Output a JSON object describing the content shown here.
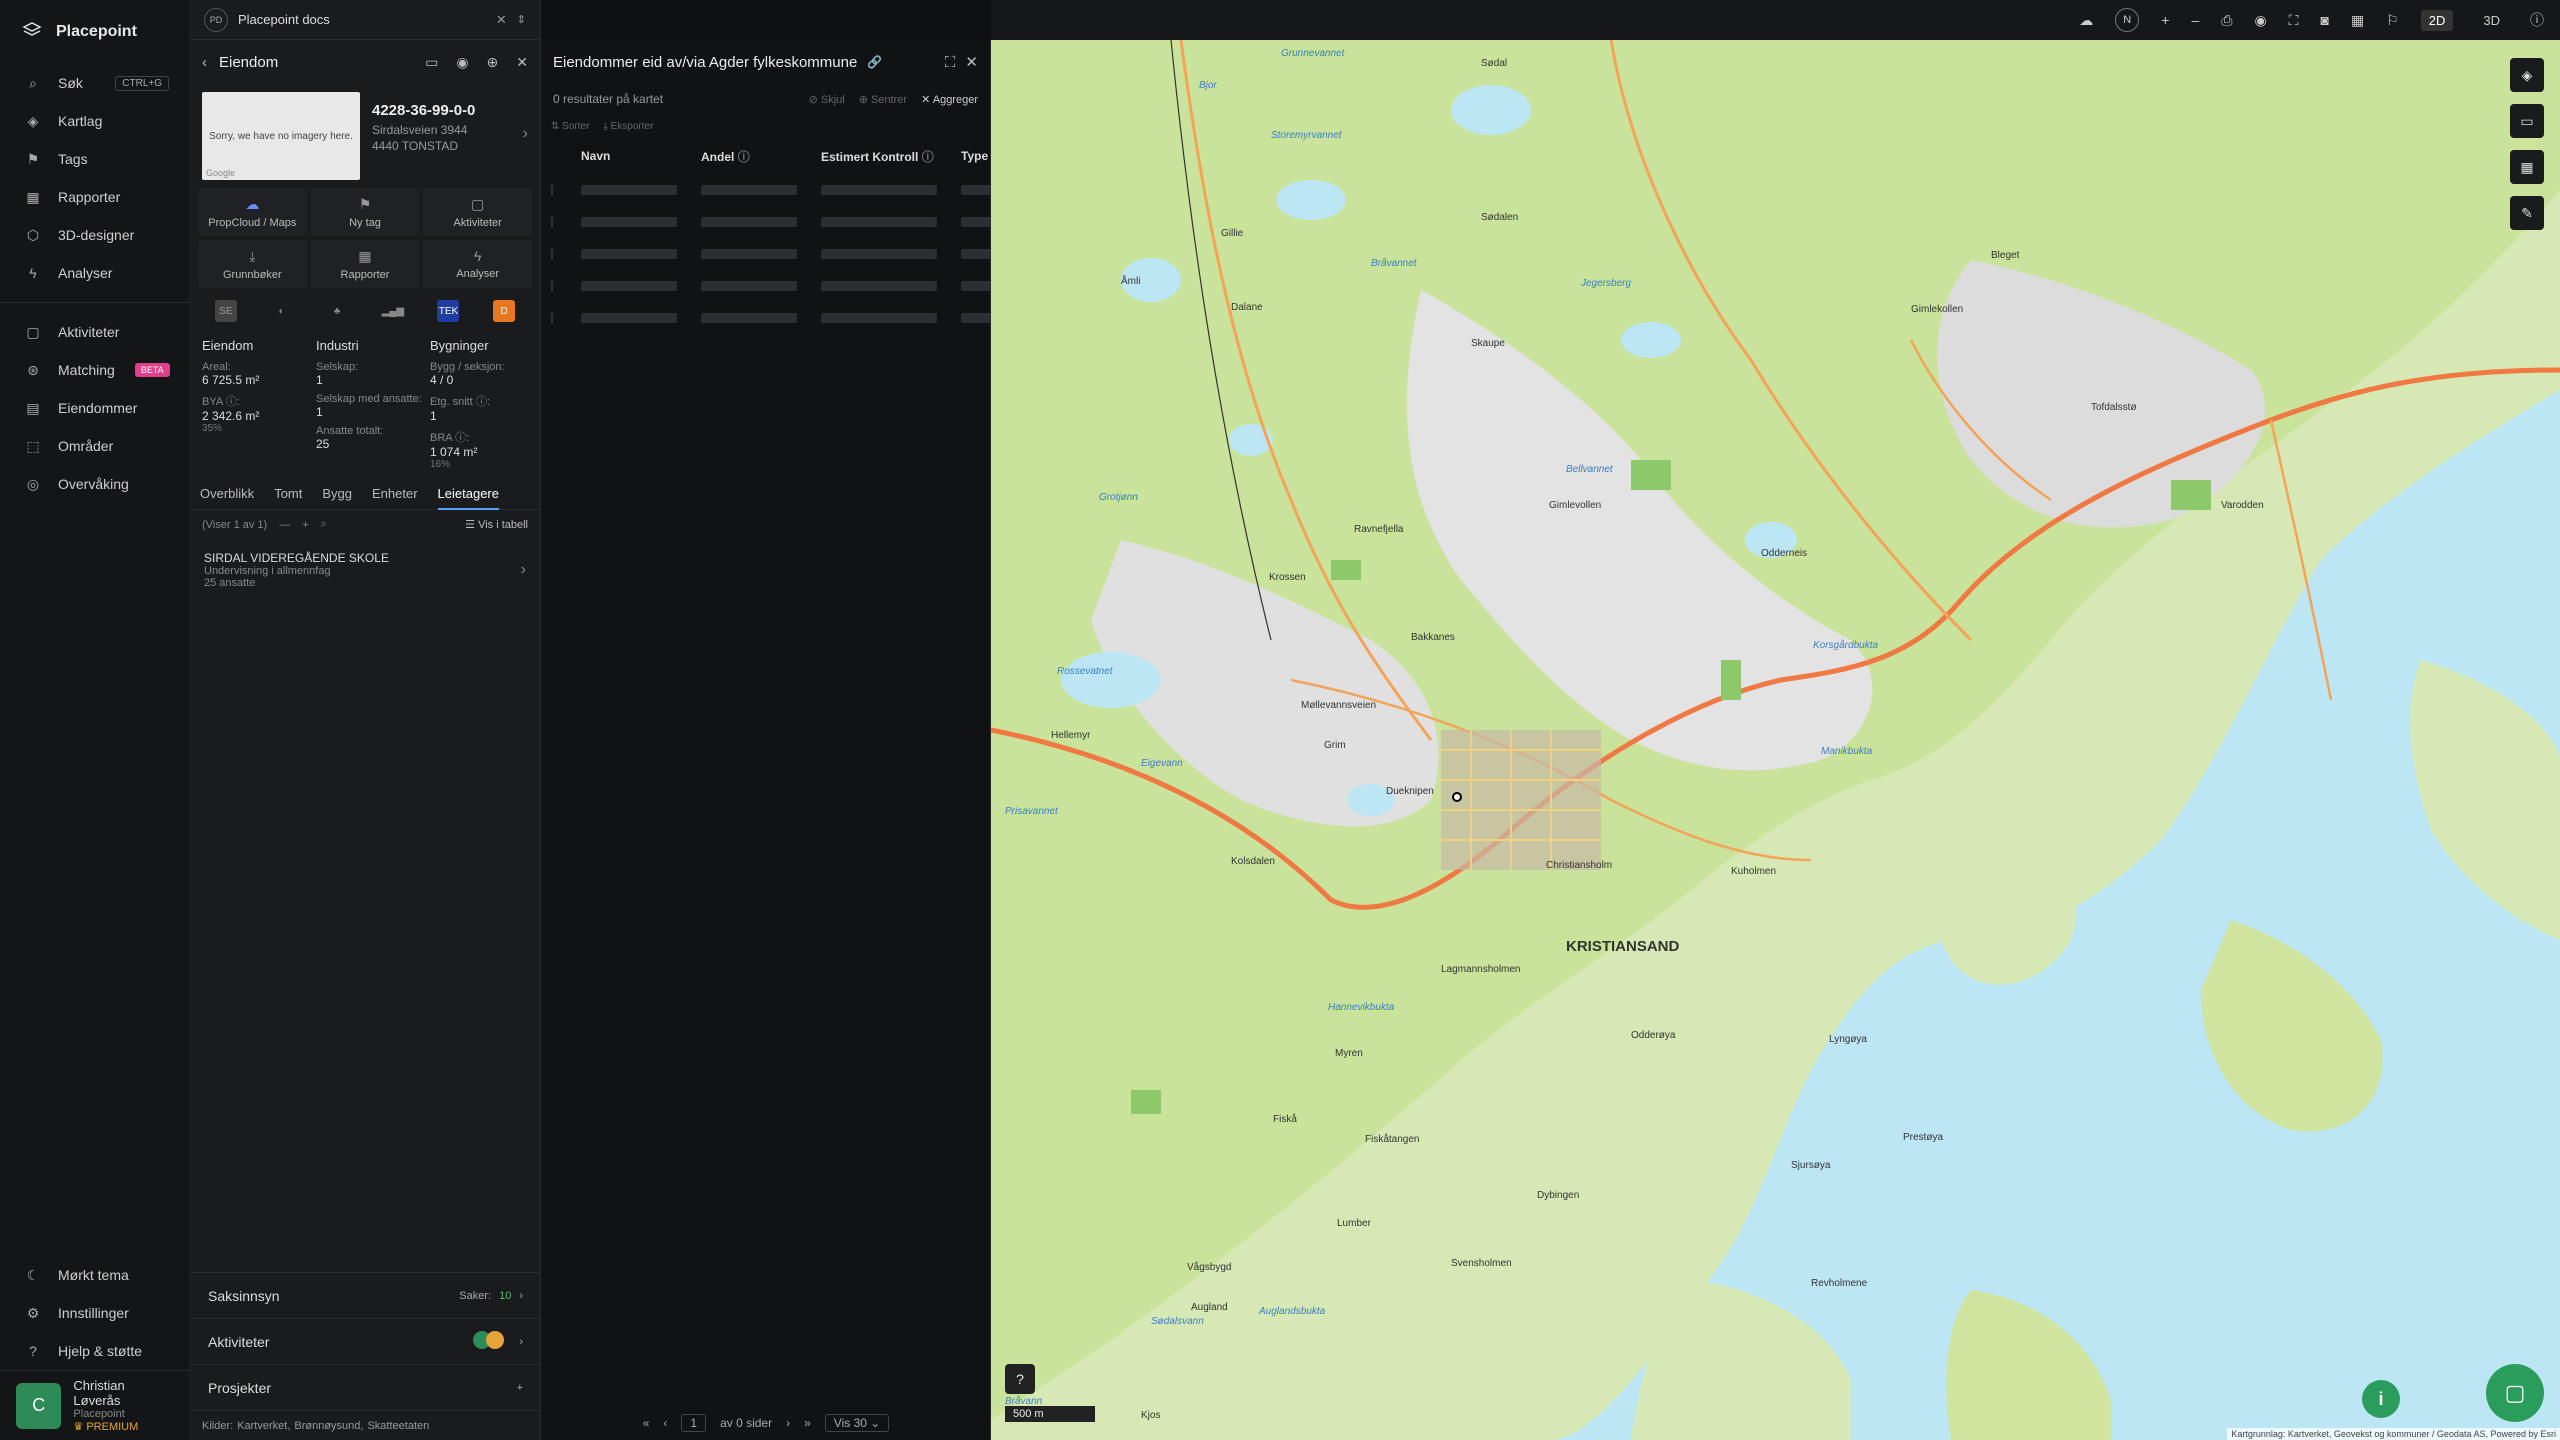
{
  "app": {
    "name": "Placepoint"
  },
  "nav": {
    "search": {
      "label": "Søk",
      "shortcut": "CTRL+G"
    },
    "items_top": [
      {
        "id": "kartlag",
        "label": "Kartlag"
      },
      {
        "id": "tags",
        "label": "Tags"
      },
      {
        "id": "rapporter",
        "label": "Rapporter"
      },
      {
        "id": "3d",
        "label": "3D-designer"
      },
      {
        "id": "analyser",
        "label": "Analyser"
      }
    ],
    "items_mid": [
      {
        "id": "aktiviteter",
        "label": "Aktiviteter"
      },
      {
        "id": "matching",
        "label": "Matching",
        "badge": "BETA"
      },
      {
        "id": "eiendommer",
        "label": "Eiendommer"
      },
      {
        "id": "omrader",
        "label": "Områder"
      },
      {
        "id": "overvaking",
        "label": "Overvåking"
      }
    ],
    "items_bottom": [
      {
        "id": "tema",
        "label": "Mørkt tema"
      },
      {
        "id": "innstillinger",
        "label": "Innstillinger"
      },
      {
        "id": "hjelp",
        "label": "Hjelp & støtte"
      }
    ],
    "user": {
      "initial": "C",
      "name": "Christian Løverås",
      "org": "Placepoint",
      "plan": "PREMIUM"
    }
  },
  "docs": {
    "badge": "PD",
    "title": "Placepoint docs"
  },
  "property": {
    "header": "Eiendom",
    "image_text": "Sorry, we have no imagery here.",
    "image_brand": "Google",
    "id": "4228-36-99-0-0",
    "address": "Sirdalsveien 3944",
    "postal": "4440 TONSTAD",
    "tiles": [
      {
        "label": "PropCloud / Maps",
        "icon": "cloud-icon"
      },
      {
        "label": "Ny tag",
        "icon": "tag-icon"
      },
      {
        "label": "Aktiviteter",
        "icon": "chat-icon"
      },
      {
        "label": "Grunnbøker",
        "icon": "download-icon"
      },
      {
        "label": "Rapporter",
        "icon": "chart-icon"
      },
      {
        "label": "Analyser",
        "icon": "bulb-icon"
      }
    ],
    "sources": [
      "SE",
      "",
      "",
      "",
      "TEK",
      "D"
    ],
    "stats": {
      "eiendom": {
        "title": "Eiendom",
        "areal_label": "Areal:",
        "areal": "6 725.5 m²",
        "bya_label": "BYA ⓘ:",
        "bya": "2 342.6 m²",
        "bya_pct": "35%"
      },
      "industri": {
        "title": "Industri",
        "selskap_label": "Selskap:",
        "selskap": "1",
        "ansatte_label": "Selskap med ansatte:",
        "ansatte": "1",
        "total_label": "Ansatte totalt:",
        "total": "25"
      },
      "bygninger": {
        "title": "Bygninger",
        "seksjon_label": "Bygg / seksjon:",
        "seksjon": "4 / 0",
        "etg_label": "Etg. snitt ⓘ:",
        "etg": "1",
        "bra_label": "BRA ⓘ:",
        "bra": "1 074 m²",
        "bra_pct": "16%"
      }
    },
    "tabs": [
      "Overblikk",
      "Tomt",
      "Bygg",
      "Enheter",
      "Leietagere"
    ],
    "active_tab": "Leietagere",
    "list_info": "(Viser 1 av 1)",
    "list_table_btn": "Vis i tabell",
    "lessee": {
      "name": "SIRDAL VIDEREGÅENDE SKOLE",
      "sector": "Undervisning i allmennfag",
      "employees": "25 ansatte"
    },
    "saksinnsyn": {
      "label": "Saksinnsyn",
      "saker_label": "Saker:",
      "saker": "10"
    },
    "aktiviteter": {
      "label": "Aktiviteter"
    },
    "prosjekter": {
      "label": "Prosjekter"
    },
    "sources_footer": {
      "label": "Kilder:",
      "items": [
        "Kartverket,",
        "Brønnøysund,",
        "Skatteetaten"
      ]
    }
  },
  "results": {
    "title": "Eiendommer eid av/via Agder fylkeskommune",
    "count_text": "0 resultater på kartet",
    "actions": [
      "Skjul",
      "Sentrer",
      "Aggreger"
    ],
    "tools": [
      "Sorter",
      "Eksporter"
    ],
    "columns": [
      "Navn",
      "Andel",
      "Estimert Kontroll",
      "Type"
    ],
    "skeleton_rows": 5,
    "pager": {
      "page": "1",
      "of_text": "av 0 sider",
      "per_page": "Vis 30"
    }
  },
  "topbar": {
    "compass": "N",
    "mode_2d": "2D",
    "mode_3d": "3D"
  },
  "map": {
    "city": "KRISTIANSAND",
    "scale": "500 m",
    "attribution": "Kartgrunnlag: Kartverket, Geovekst og kommuner / Geodata AS, Powered by Esri",
    "labels": [
      "Grunnevannet",
      "Sødal",
      "Bjor",
      "Storemyrvannet",
      "Gillie",
      "Åmli",
      "Dalane",
      "Bråvannet",
      "Skaupe",
      "Sødalen",
      "Jegersberg",
      "Gimlekollen",
      "Bleget",
      "Tofdalsstø",
      "Krossen",
      "Bakkanes",
      "Ravnefjella",
      "Gimlevollen",
      "Odderneis",
      "Varodden",
      "Møllevannsveien",
      "Grim",
      "Dueknipen",
      "Christiansholm",
      "Kuholmen",
      "Lagmannsholmen",
      "Odderøya",
      "Hannevikbukta",
      "Myren",
      "Fiskå",
      "Fiskåtangen",
      "Lumber",
      "Dybingen",
      "Svensholmen",
      "Revholmene",
      "Lyngøya",
      "Prestøya",
      "Sjursøya",
      "Vågsbygd",
      "Augland",
      "Auglandsbukta",
      "Bråvann",
      "Korsgårdbukta",
      "Manikbukta",
      "Kjos",
      "Prisavannet",
      "Hellemyr",
      "Eigevann",
      "Rossevatnet",
      "Grotjønn",
      "Bellvannet",
      "Sødalsvann",
      "Kolsdalen"
    ]
  }
}
